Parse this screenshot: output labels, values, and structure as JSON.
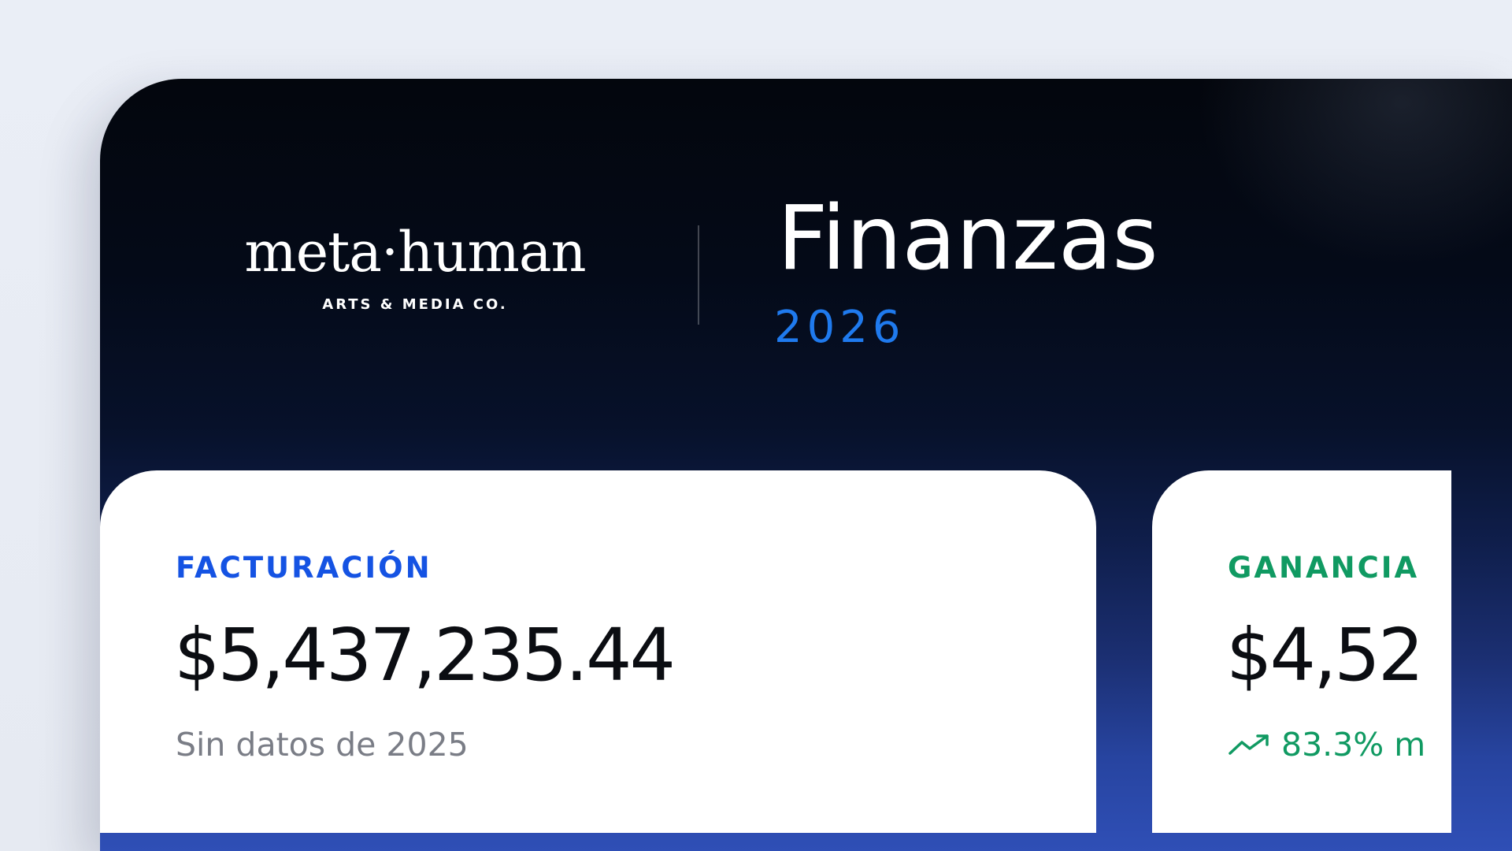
{
  "brand": {
    "name": "meta·human",
    "tagline": "ARTS & MEDIA CO."
  },
  "header": {
    "title": "Finanzas",
    "year": "2026"
  },
  "cards": [
    {
      "label": "FACTURACIÓN",
      "value": "$5,437,235.44",
      "note": "Sin datos de 2025"
    },
    {
      "label": "GANANCIA",
      "value": "$4,52",
      "trend": "83.3% m",
      "trend_icon": "trending-up-icon"
    }
  ],
  "colors": {
    "accent_blue": "#1f7aee",
    "label_blue": "#1553e3",
    "label_green": "#109a62",
    "panel_dark": "#03060d",
    "panel_blue": "#2f4fb6"
  }
}
